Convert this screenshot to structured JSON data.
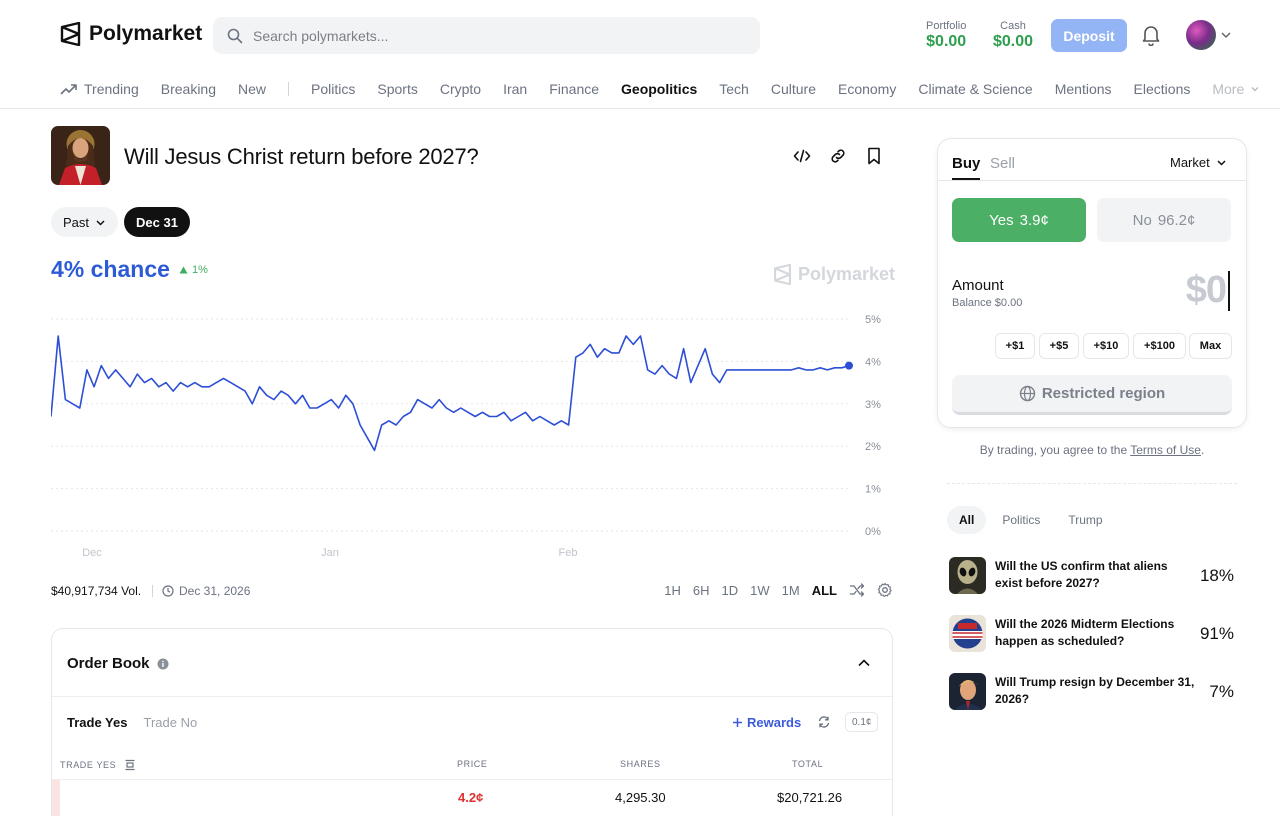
{
  "header": {
    "brand": "Polymarket",
    "search_placeholder": "Search polymarkets...",
    "portfolio_label": "Portfolio",
    "portfolio_value": "$0.00",
    "cash_label": "Cash",
    "cash_value": "$0.00",
    "deposit_label": "Deposit"
  },
  "nav": {
    "items": [
      "Trending",
      "Breaking",
      "New",
      "Politics",
      "Sports",
      "Crypto",
      "Iran",
      "Finance",
      "Geopolitics",
      "Tech",
      "Culture",
      "Economy",
      "Climate & Science",
      "Mentions",
      "Elections",
      "More"
    ],
    "active": "Geopolitics"
  },
  "market": {
    "title": "Will Jesus Christ return before 2027?",
    "filter_past": "Past",
    "filter_date": "Dec 31",
    "chance": "4% chance",
    "change": "1%",
    "watermark": "Polymarket",
    "volume": "$40,917,734 Vol.",
    "end_date": "Dec 31, 2026",
    "ranges": [
      "1H",
      "6H",
      "1D",
      "1W",
      "1M",
      "ALL"
    ],
    "active_range": "ALL"
  },
  "chart_data": {
    "type": "line",
    "x_labels": [
      "Dec",
      "Jan",
      "Feb"
    ],
    "y_ticks": [
      "5%",
      "4%",
      "3%",
      "2%",
      "1%",
      "0%"
    ],
    "ylim": [
      0,
      5
    ],
    "grid": true,
    "series": [
      {
        "color": "#2d4fd6",
        "values": [
          2.7,
          4.6,
          3.1,
          3.0,
          2.9,
          3.8,
          3.4,
          3.9,
          3.6,
          3.8,
          3.6,
          3.4,
          3.7,
          3.5,
          3.6,
          3.4,
          3.5,
          3.3,
          3.5,
          3.4,
          3.5,
          3.4,
          3.4,
          3.5,
          3.6,
          3.5,
          3.4,
          3.3,
          3.0,
          3.4,
          3.2,
          3.1,
          3.3,
          3.2,
          3.0,
          3.2,
          2.9,
          2.9,
          3.0,
          3.1,
          2.9,
          3.2,
          3.0,
          2.5,
          2.2,
          1.9,
          2.5,
          2.6,
          2.5,
          2.7,
          2.8,
          3.1,
          3.0,
          2.9,
          3.1,
          2.9,
          2.8,
          2.9,
          2.8,
          2.7,
          2.8,
          2.7,
          2.7,
          2.8,
          2.6,
          2.7,
          2.8,
          2.6,
          2.7,
          2.6,
          2.5,
          2.6,
          2.5,
          4.1,
          4.2,
          4.4,
          4.1,
          4.3,
          4.2,
          4.2,
          4.6,
          4.4,
          4.6,
          3.8,
          3.7,
          3.9,
          3.7,
          3.6,
          4.3,
          3.5,
          3.9,
          4.3,
          3.7,
          3.5,
          3.8,
          3.8,
          3.8,
          3.8,
          3.8,
          3.8,
          3.8,
          3.8,
          3.8,
          3.8,
          3.85,
          3.8,
          3.8,
          3.85,
          3.8,
          3.85,
          3.85,
          3.9
        ]
      }
    ]
  },
  "order_book": {
    "title": "Order Book",
    "tab_yes": "Trade Yes",
    "tab_no": "Trade No",
    "rewards": "Rewards",
    "tick": "0.1¢",
    "col_label": "TRADE YES",
    "col_price": "PRICE",
    "col_shares": "SHARES",
    "col_total": "TOTAL",
    "rows": [
      {
        "price": "4.2¢",
        "shares": "4,295.30",
        "total": "$20,721.26"
      }
    ]
  },
  "trade": {
    "buy": "Buy",
    "sell": "Sell",
    "order_type": "Market",
    "yes_label": "Yes",
    "yes_price": "3.9¢",
    "no_label": "No",
    "no_price": "96.2¢",
    "amount_label": "Amount",
    "balance": "Balance $0.00",
    "amount_value": "$0",
    "quick_amounts": [
      "+$1",
      "+$5",
      "+$10",
      "+$100",
      "Max"
    ],
    "restricted": "Restricted region",
    "terms_prefix": "By trading, you agree to the ",
    "terms_link": "Terms of Use",
    "terms_suffix": "."
  },
  "related": {
    "tabs": [
      "All",
      "Politics",
      "Trump"
    ],
    "active_tab": "All",
    "items": [
      {
        "question": "Will the US confirm that aliens exist before 2027?",
        "percent": "18%"
      },
      {
        "question": "Will the 2026 Midterm Elections happen as scheduled?",
        "percent": "91%"
      },
      {
        "question": "Will Trump resign by December 31, 2026?",
        "percent": "7%"
      }
    ]
  },
  "colors": {
    "accent_blue": "#2d5bd6",
    "yes_green": "#4caf66",
    "deposit": "#93b4f5",
    "cash_green": "#2e9e4f"
  }
}
